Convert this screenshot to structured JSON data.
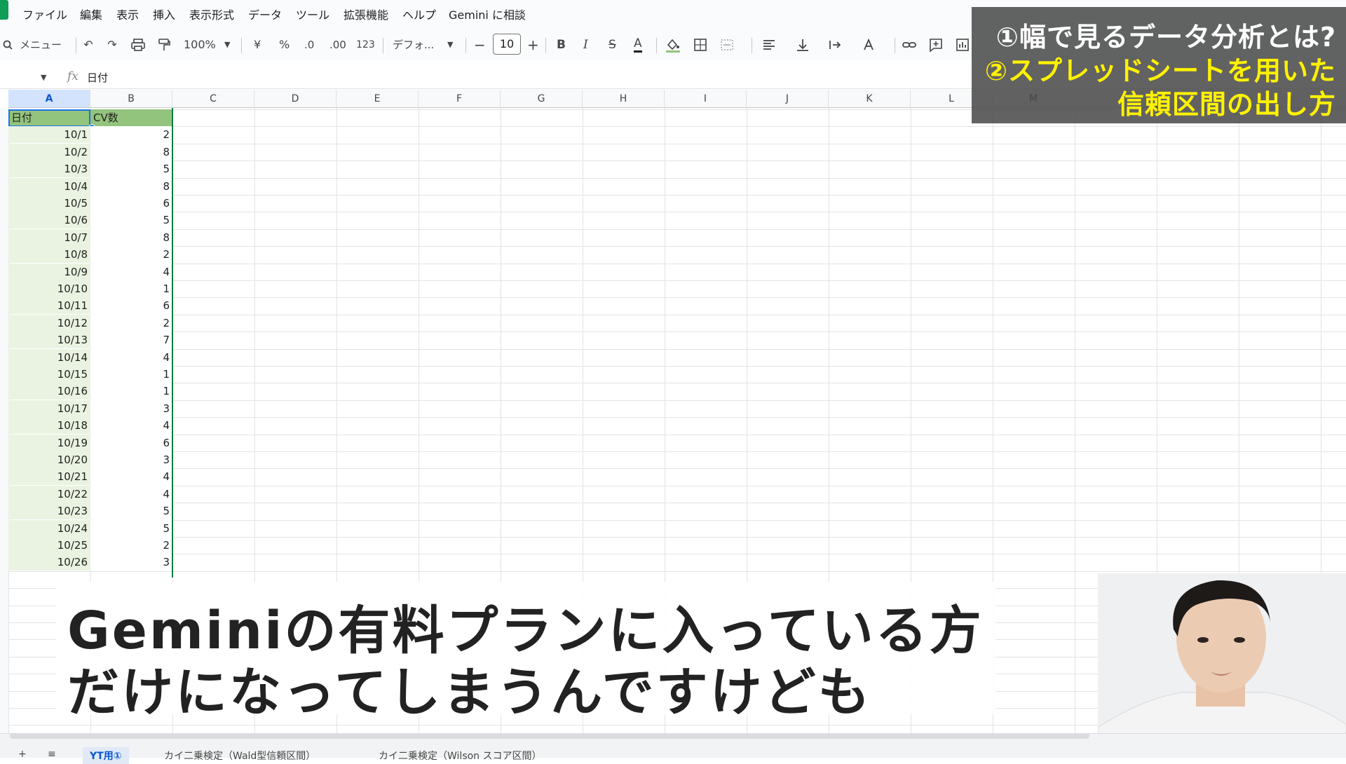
{
  "menu": [
    "ファイル",
    "編集",
    "表示",
    "挿入",
    "表示形式",
    "データ",
    "ツール",
    "拡張機能",
    "ヘルプ",
    "Gemini に相談"
  ],
  "toolbar": {
    "search_label": "メニュー",
    "zoom": "100%",
    "currency": "¥",
    "percent": "%",
    "dec_decrease": ".0",
    "dec_increase": ".00",
    "number_format": "123",
    "font": "デフォ...",
    "minus": "−",
    "font_size": "10",
    "plus": "+",
    "bold": "B",
    "italic": "I",
    "strike": "S",
    "text_color": "A"
  },
  "formula_bar": {
    "fx": "fx",
    "content": "日付"
  },
  "columns": [
    "A",
    "B",
    "C",
    "D",
    "E",
    "F",
    "G",
    "H",
    "I",
    "J",
    "K",
    "L",
    "M"
  ],
  "headers": {
    "a": "日付",
    "b": "CV数"
  },
  "rows": [
    {
      "date": "10/1",
      "cv": "2"
    },
    {
      "date": "10/2",
      "cv": "8"
    },
    {
      "date": "10/3",
      "cv": "5"
    },
    {
      "date": "10/4",
      "cv": "8"
    },
    {
      "date": "10/5",
      "cv": "6"
    },
    {
      "date": "10/6",
      "cv": "5"
    },
    {
      "date": "10/7",
      "cv": "8"
    },
    {
      "date": "10/8",
      "cv": "2"
    },
    {
      "date": "10/9",
      "cv": "4"
    },
    {
      "date": "10/10",
      "cv": "1"
    },
    {
      "date": "10/11",
      "cv": "6"
    },
    {
      "date": "10/12",
      "cv": "2"
    },
    {
      "date": "10/13",
      "cv": "7"
    },
    {
      "date": "10/14",
      "cv": "4"
    },
    {
      "date": "10/15",
      "cv": "1"
    },
    {
      "date": "10/16",
      "cv": "1"
    },
    {
      "date": "10/17",
      "cv": "3"
    },
    {
      "date": "10/18",
      "cv": "4"
    },
    {
      "date": "10/19",
      "cv": "6"
    },
    {
      "date": "10/20",
      "cv": "3"
    },
    {
      "date": "10/21",
      "cv": "4"
    },
    {
      "date": "10/22",
      "cv": "4"
    },
    {
      "date": "10/23",
      "cv": "5"
    },
    {
      "date": "10/24",
      "cv": "5"
    },
    {
      "date": "10/25",
      "cv": "2"
    },
    {
      "date": "10/26",
      "cv": "3"
    }
  ],
  "overlay_title": {
    "line1": "①幅で見るデータ分析とは?",
    "line2": "②スプレッドシートを用いた",
    "line3": "信頼区間の出し方",
    "line1_color": "#ffffff",
    "line2_color": "#fff200",
    "line3_color": "#fff200"
  },
  "subtitle": {
    "line1": "Geminiの有料プランに入っている方",
    "line2": "だけになってしまうんですけども"
  },
  "sheet_tabs": [
    "+",
    "≡",
    "YT用①",
    "カイ二乗検定（Wald型信頼区間）",
    "カイ二乗検定（Wilson スコア区間）"
  ]
}
